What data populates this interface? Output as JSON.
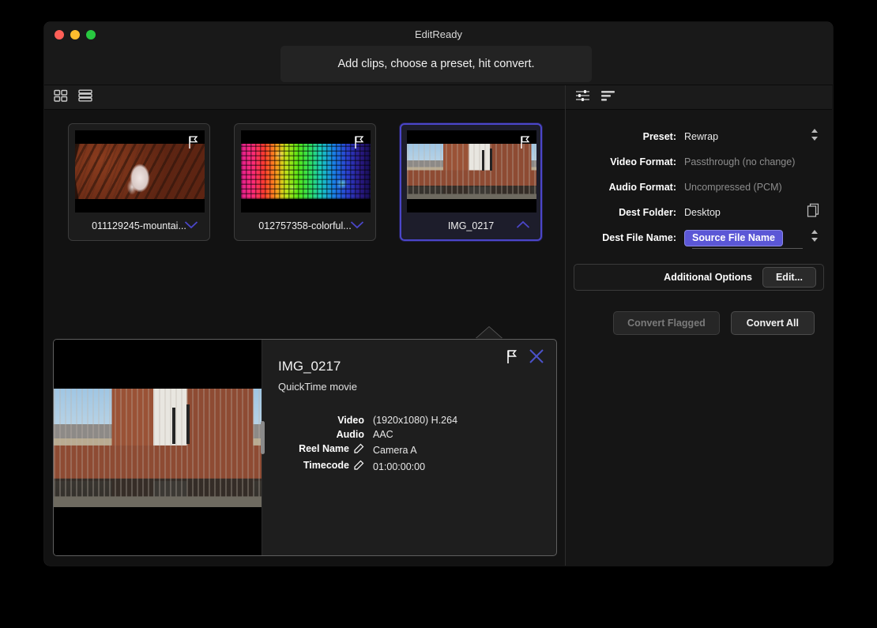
{
  "window": {
    "title": "EditReady",
    "traffic_lights": [
      "close",
      "minimize",
      "maximize"
    ],
    "drop_zone_text": "Add clips, choose a preset, hit convert."
  },
  "main_toolbar": {
    "icons": [
      {
        "name": "grid-view-icon",
        "label": "Grid view"
      },
      {
        "name": "list-view-icon",
        "label": "List view"
      }
    ]
  },
  "side_toolbar": {
    "icons": [
      {
        "name": "sliders-icon",
        "label": "Settings"
      },
      {
        "name": "sort-list-icon",
        "label": "Queue"
      }
    ]
  },
  "clips": [
    {
      "title": "011129245-mountai...",
      "thumb_class": "img-mountain",
      "selected": false,
      "flagged": false,
      "chevron": "chevron-down"
    },
    {
      "title": "012757358-colorful...",
      "thumb_class": "img-equalizer",
      "selected": false,
      "flagged": false,
      "chevron": "chevron-down"
    },
    {
      "title": "IMG_0217",
      "thumb_class": "img-city",
      "selected": true,
      "flagged": false,
      "chevron": "chevron-up"
    }
  ],
  "detail": {
    "title": "IMG_0217",
    "subtitle": "QuickTime movie",
    "rows": [
      {
        "key": "Video",
        "value": "(1920x1080) H.264",
        "editable": false
      },
      {
        "key": "Audio",
        "value": "AAC",
        "editable": false
      },
      {
        "key": "Reel Name",
        "value": "Camera A",
        "editable": true
      },
      {
        "key": "Timecode",
        "value": "01:00:00:00",
        "editable": true
      }
    ],
    "actions": [
      {
        "name": "flag-icon",
        "label": "Flag"
      },
      {
        "name": "close-icon",
        "label": "Close"
      }
    ]
  },
  "settings": {
    "fields": [
      {
        "label": "Preset:",
        "value": "Rewrap",
        "dim": false,
        "control": "stepper"
      },
      {
        "label": "Video Format:",
        "value": "Passthrough (no change)",
        "dim": true,
        "control": "none"
      },
      {
        "label": "Audio Format:",
        "value": "Uncompressed (PCM)",
        "dim": true,
        "control": "none"
      },
      {
        "label": "Dest Folder:",
        "value": "Desktop",
        "dim": false,
        "control": "folder"
      }
    ],
    "dest_file_name": {
      "label": "Dest File Name:",
      "token": "Source File Name",
      "control": "stepper"
    },
    "additional_options": {
      "label": "Additional Options",
      "edit_button": "Edit..."
    },
    "buttons": {
      "convert_flagged": "Convert Flagged",
      "convert_all": "Convert All"
    }
  },
  "colors": {
    "accent": "#5b57d6",
    "selected_border": "#4b46c9",
    "window_bg": "#151515",
    "main_bg": "#121212",
    "titlebar_bg": "#191919",
    "close_light": "#ff5f57",
    "min_light": "#febc2e",
    "max_light": "#28c840"
  }
}
